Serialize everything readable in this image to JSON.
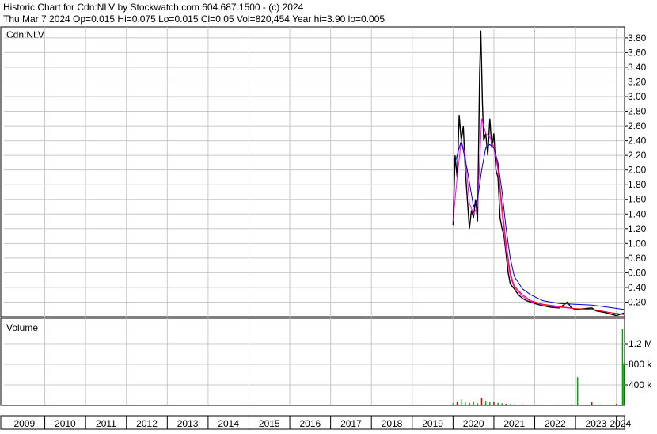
{
  "header": {
    "line1": "Historic Chart for Cdn:NLV by Stockwatch.com 604.687.1500 - (c) 2024",
    "line2": "Thu Mar  7 2024   Op=0.015   Hi=0.075   Lo=0.015   Cl=0.05   Vol=820,454   Year hi=3.90   lo=0.005"
  },
  "price_panel": {
    "label": "Cdn:NLV"
  },
  "volume_panel": {
    "label": "Volume"
  },
  "colors": {
    "price": "#000000",
    "ma_short": "#ff00ff",
    "ma_red": "#ff0000",
    "ma_long": "#0000cc",
    "vol_up": "#00aa00",
    "vol_down": "#cc0000",
    "grid": "#c8c8c8",
    "axis": "#000000"
  },
  "chart_data": [
    {
      "type": "line",
      "title": "Cdn:NLV",
      "ylim": [
        0,
        3.95
      ],
      "y_ticks": [
        "0.20",
        "0.40",
        "0.60",
        "0.80",
        "1.00",
        "1.20",
        "1.40",
        "1.60",
        "1.80",
        "2.00",
        "2.20",
        "2.40",
        "2.60",
        "2.80",
        "3.00",
        "3.20",
        "3.40",
        "3.60",
        "3.80"
      ],
      "grid": true,
      "series": [
        {
          "kind": "price",
          "points": [
            [
              2020.0,
              1.25
            ],
            [
              2020.05,
              2.2
            ],
            [
              2020.1,
              1.9
            ],
            [
              2020.15,
              2.75
            ],
            [
              2020.2,
              2.4
            ],
            [
              2020.25,
              2.6
            ],
            [
              2020.3,
              2.0
            ],
            [
              2020.35,
              1.6
            ],
            [
              2020.4,
              1.2
            ],
            [
              2020.45,
              1.45
            ],
            [
              2020.5,
              1.35
            ],
            [
              2020.55,
              1.6
            ],
            [
              2020.6,
              1.3
            ],
            [
              2020.65,
              3.3
            ],
            [
              2020.68,
              3.9
            ],
            [
              2020.72,
              2.9
            ],
            [
              2020.75,
              2.4
            ],
            [
              2020.8,
              2.5
            ],
            [
              2020.85,
              2.2
            ],
            [
              2020.9,
              2.7
            ],
            [
              2020.95,
              2.3
            ],
            [
              2021.0,
              2.5
            ],
            [
              2021.05,
              2.0
            ],
            [
              2021.1,
              1.9
            ],
            [
              2021.15,
              1.35
            ],
            [
              2021.2,
              1.2
            ],
            [
              2021.25,
              1.1
            ],
            [
              2021.3,
              0.85
            ],
            [
              2021.35,
              0.6
            ],
            [
              2021.4,
              0.45
            ],
            [
              2021.5,
              0.38
            ],
            [
              2021.6,
              0.3
            ],
            [
              2021.7,
              0.25
            ],
            [
              2021.8,
              0.22
            ],
            [
              2021.9,
              0.2
            ],
            [
              2022.0,
              0.18
            ],
            [
              2022.2,
              0.15
            ],
            [
              2022.4,
              0.13
            ],
            [
              2022.6,
              0.12
            ],
            [
              2022.8,
              0.2
            ],
            [
              2022.9,
              0.12
            ],
            [
              2023.0,
              0.1
            ],
            [
              2023.2,
              0.11
            ],
            [
              2023.4,
              0.12
            ],
            [
              2023.5,
              0.08
            ],
            [
              2023.7,
              0.06
            ],
            [
              2023.9,
              0.03
            ],
            [
              2024.0,
              0.015
            ],
            [
              2024.18,
              0.05
            ]
          ]
        },
        {
          "kind": "ma_short",
          "points": [
            [
              2020.0,
              1.3
            ],
            [
              2020.1,
              1.9
            ],
            [
              2020.2,
              2.4
            ],
            [
              2020.3,
              2.2
            ],
            [
              2020.4,
              1.55
            ],
            [
              2020.5,
              1.4
            ],
            [
              2020.6,
              1.5
            ],
            [
              2020.7,
              2.7
            ],
            [
              2020.8,
              2.5
            ],
            [
              2020.9,
              2.45
            ],
            [
              2021.0,
              2.3
            ],
            [
              2021.1,
              2.0
            ],
            [
              2021.2,
              1.4
            ],
            [
              2021.3,
              0.9
            ],
            [
              2021.4,
              0.55
            ],
            [
              2021.5,
              0.4
            ],
            [
              2021.7,
              0.28
            ],
            [
              2021.9,
              0.21
            ],
            [
              2022.2,
              0.16
            ],
            [
              2022.6,
              0.13
            ],
            [
              2023.0,
              0.11
            ],
            [
              2023.4,
              0.1
            ],
            [
              2023.8,
              0.06
            ],
            [
              2024.18,
              0.03
            ]
          ]
        },
        {
          "kind": "ma_red",
          "points": [
            [
              2021.0,
              2.35
            ],
            [
              2021.1,
              2.05
            ],
            [
              2021.2,
              1.5
            ],
            [
              2021.3,
              1.0
            ],
            [
              2021.4,
              0.6
            ],
            [
              2021.5,
              0.42
            ],
            [
              2021.7,
              0.3
            ],
            [
              2021.9,
              0.22
            ],
            [
              2022.2,
              0.17
            ],
            [
              2022.6,
              0.14
            ],
            [
              2023.0,
              0.11
            ],
            [
              2023.4,
              0.1
            ],
            [
              2023.8,
              0.06
            ],
            [
              2024.18,
              0.03
            ]
          ]
        },
        {
          "kind": "ma_long",
          "points": [
            [
              2020.05,
              2.1
            ],
            [
              2020.2,
              2.4
            ],
            [
              2020.35,
              2.0
            ],
            [
              2020.5,
              1.5
            ],
            [
              2020.6,
              1.6
            ],
            [
              2020.7,
              2.0
            ],
            [
              2020.8,
              2.3
            ],
            [
              2020.9,
              2.35
            ],
            [
              2021.0,
              2.3
            ],
            [
              2021.1,
              2.1
            ],
            [
              2021.2,
              1.7
            ],
            [
              2021.3,
              1.2
            ],
            [
              2021.4,
              0.8
            ],
            [
              2021.5,
              0.55
            ],
            [
              2021.7,
              0.38
            ],
            [
              2021.9,
              0.3
            ],
            [
              2022.2,
              0.22
            ],
            [
              2022.6,
              0.18
            ],
            [
              2023.0,
              0.17
            ],
            [
              2023.4,
              0.16
            ],
            [
              2023.8,
              0.13
            ],
            [
              2024.18,
              0.1
            ]
          ]
        }
      ]
    },
    {
      "type": "bar",
      "title": "Volume",
      "ylim": [
        0,
        1600000
      ],
      "y_ticks": [
        "400 k",
        "800 k",
        "1.2 M"
      ],
      "bars": [
        [
          2020.0,
          40000
        ],
        [
          2020.1,
          60000
        ],
        [
          2020.2,
          120000
        ],
        [
          2020.3,
          70000
        ],
        [
          2020.4,
          50000
        ],
        [
          2020.5,
          80000
        ],
        [
          2020.6,
          40000
        ],
        [
          2020.7,
          150000
        ],
        [
          2020.8,
          90000
        ],
        [
          2020.9,
          60000
        ],
        [
          2021.0,
          70000
        ],
        [
          2021.1,
          50000
        ],
        [
          2021.2,
          40000
        ],
        [
          2021.3,
          30000
        ],
        [
          2021.4,
          25000
        ],
        [
          2021.5,
          20000
        ],
        [
          2021.7,
          20000
        ],
        [
          2021.9,
          15000
        ],
        [
          2022.2,
          15000
        ],
        [
          2022.6,
          12000
        ],
        [
          2022.9,
          20000
        ],
        [
          2023.05,
          550000
        ],
        [
          2023.4,
          60000
        ],
        [
          2023.6,
          20000
        ],
        [
          2023.8,
          15000
        ],
        [
          2024.0,
          30000
        ],
        [
          2024.15,
          1480000
        ],
        [
          2024.18,
          820454
        ]
      ]
    }
  ],
  "x_axis": {
    "years": [
      "2009",
      "2010",
      "2011",
      "2012",
      "2013",
      "2014",
      "2015",
      "2016",
      "2017",
      "2018",
      "2019",
      "2020",
      "2021",
      "2022",
      "2023",
      "2024"
    ]
  }
}
